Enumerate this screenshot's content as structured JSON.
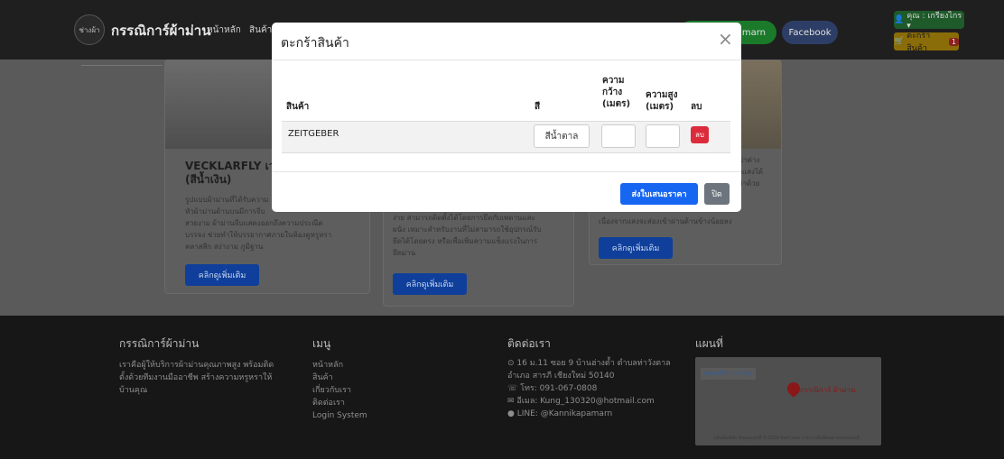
{
  "nav": {
    "logo_text": "ช่างผ้า",
    "brand": "กรรณิการ์ผ้าม่าน",
    "links": [
      "หน้าหลัก",
      "สินค้า"
    ],
    "green_button": "amarn",
    "facebook": "Facebook",
    "user": "คุณ : เกรียงไกร ▾",
    "cart": "ตะกร้าสินค้า",
    "cart_count": "1"
  },
  "cards": [
    {
      "title": "VECKLARFLY เว\n(สีน้ำเงิน)",
      "desc": "รูปแบบผ้าม่านที่ได้รับความ\nหัวผ้าม่านด้านบนมีการจีบ\nสวยงาม ผ้าม่านจีบแสดงออกถึงความประณีต\nบรรจง ช่วยทำให้บรรยากาศภายในห้องดูหรูหรา\nคลาสสิก สง่างาม ภูมิฐาน",
      "button": "คลิกดูเพิ่มเติม"
    },
    {
      "desc": "ง่าย สามารถติดตั้งได้โดยการยึดกับเพดานและ\nผนัง เหมาะสำหรับงานที่ไม่สามารถใช้อุปกรณ์รับ\nยึดได้โดยตรง หรือเพื่อเพิ่มความแข็งแรงในการ\nยึดม่าน",
      "button": "คลิกดูเพิ่มเติม"
    },
    {
      "desc_right": "ม่าต่าง\nงแสงได้\nว่าด้วย",
      "desc": "เนื่องจากแสงจะส่องเข้าผ่านด้านข้างน้อยลง",
      "button": "คลิกดูเพิ่มเติม"
    }
  ],
  "footer": {
    "about_title": "กรรณิการ์ผ้าม่าน",
    "about_text": "เราคือผู้ให้บริการผ้าม่านคุณภาพสูง พร้อมติด\nตั้งด้วยทีมงานมืออาชีพ สร้างความหรูหราให้\nบ้านคุณ",
    "menu_title": "เมนู",
    "menu_items": "หน้าหลัก\nสินค้า\nเกี่ยวกับเรา\nติดต่อเรา\nLogin System",
    "contact_title": "ติดต่อเรา",
    "contact_text": "⊙ 16 ม.11 ซอย 9 บ้านฮ่างต้ำ ตำบลท่าวังตาล\nอำเภอ สารภี เชียงใหม่ 50140\n☏ โทร: 091-067-0808\n✉ อีเมล: Kung_130320@hotmail.com\n● LINE: @Kannikapamarn",
    "map_title": "แผนที่",
    "map_top": "ดูแผนที่ขนาดใหญ่",
    "map_label": "กรรณิการ์ ผ้าม่าน",
    "map_foot": "แป้นพิมพ์ลัด ข้อมูลแผนที่ ©2024 ข้อกำหนด รายงานข้อผิดพลาดของแผนที่"
  },
  "modal": {
    "title": "ตะกร้าสินค้า",
    "close_symbol": "×",
    "columns": {
      "product": "สินค้า",
      "color": "สี",
      "width": "ความ\nกว้าง\n(เมตร)",
      "height": "ความสูง\n(เมตร)",
      "delete": "ลบ"
    },
    "rows": [
      {
        "product": "ZEITGEBER",
        "color": "สีน้ำตาล",
        "width": "",
        "height": "",
        "delete_label": "ลบ"
      }
    ],
    "submit": "ส่งใบเสนอราคา",
    "close": "ปิด"
  }
}
